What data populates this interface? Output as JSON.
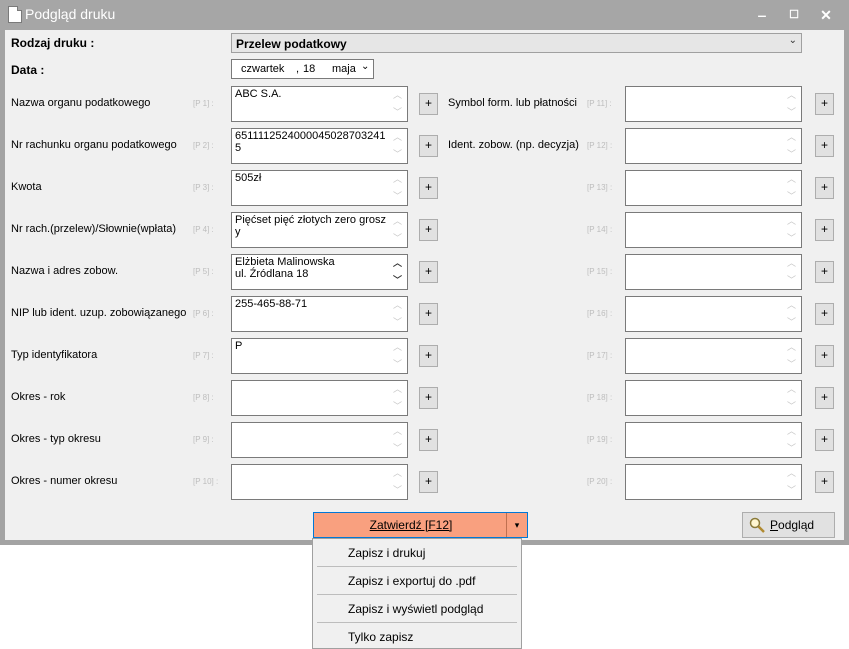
{
  "window": {
    "title": "Podgląd druku",
    "minimize": "‒",
    "maximize": "☐",
    "close": "✕"
  },
  "header": {
    "rodzaj_label": "Rodzaj druku :",
    "rodzaj_value": "Przelew podatkowy",
    "data_label": "Data :",
    "date_weekday": "czwartek",
    "date_sep": ",",
    "date_day": "18",
    "date_month": "maja"
  },
  "left_rows": [
    {
      "label": "Nazwa organu podatkowego",
      "tag": "[P 1] :",
      "value": "ABC S.A."
    },
    {
      "label": "Nr rachunku organu podatkowego",
      "tag": "[P 2] :",
      "value": "6511112524000045028703241\n5"
    },
    {
      "label": "Kwota",
      "tag": "[P 3] :",
      "value": "505zł"
    },
    {
      "label": "Nr rach.(przelew)/Słownie(wpłata)",
      "tag": "[P 4] :",
      "value": "Pięćset pięć złotych zero groszy"
    },
    {
      "label": "Nazwa i adres zobow.",
      "tag": "[P 5] :",
      "value": "Elżbieta Malinowska\nul. Źródlana 18"
    },
    {
      "label": "NIP lub ident. uzup. zobowiązanego",
      "tag": "[P 6] :",
      "value": "255-465-88-71"
    },
    {
      "label": "Typ identyfikatora",
      "tag": "[P 7] :",
      "value": "P"
    },
    {
      "label": "Okres - rok",
      "tag": "[P 8] :",
      "value": ""
    },
    {
      "label": "Okres - typ okresu",
      "tag": "[P 9] :",
      "value": ""
    },
    {
      "label": "Okres - numer okresu",
      "tag": "[P 10] :",
      "value": ""
    }
  ],
  "right_rows": [
    {
      "label": "Symbol form. lub płatności",
      "tag": "[P 11] :",
      "value": ""
    },
    {
      "label": "Ident. zobow. (np. decyzja)",
      "tag": "[P 12] :",
      "value": ""
    },
    {
      "label": "",
      "tag": "[P 13] :",
      "value": ""
    },
    {
      "label": "",
      "tag": "[P 14] :",
      "value": ""
    },
    {
      "label": "",
      "tag": "[P 15] :",
      "value": ""
    },
    {
      "label": "",
      "tag": "[P 16] :",
      "value": ""
    },
    {
      "label": "",
      "tag": "[P 17] :",
      "value": ""
    },
    {
      "label": "",
      "tag": "[P 18] :",
      "value": ""
    },
    {
      "label": "",
      "tag": "[P 19] :",
      "value": ""
    },
    {
      "label": "",
      "tag": "[P 20] :",
      "value": ""
    }
  ],
  "plus_label": "+",
  "scroll_up": "︿",
  "scroll_down": "﹀",
  "buttons": {
    "confirm": "Zatwierdź [F12]",
    "confirm_arrow": "▾",
    "preview": "Podgląd"
  },
  "menu": [
    "Zapisz i drukuj",
    "Zapisz i exportuj  do .pdf",
    "Zapisz i wyświetl podgląd",
    "Tylko zapisz"
  ],
  "colors": {
    "title_bar": "#a6a6a6",
    "confirm_bg": "#f9a07f",
    "focus_border": "#0078d7"
  }
}
